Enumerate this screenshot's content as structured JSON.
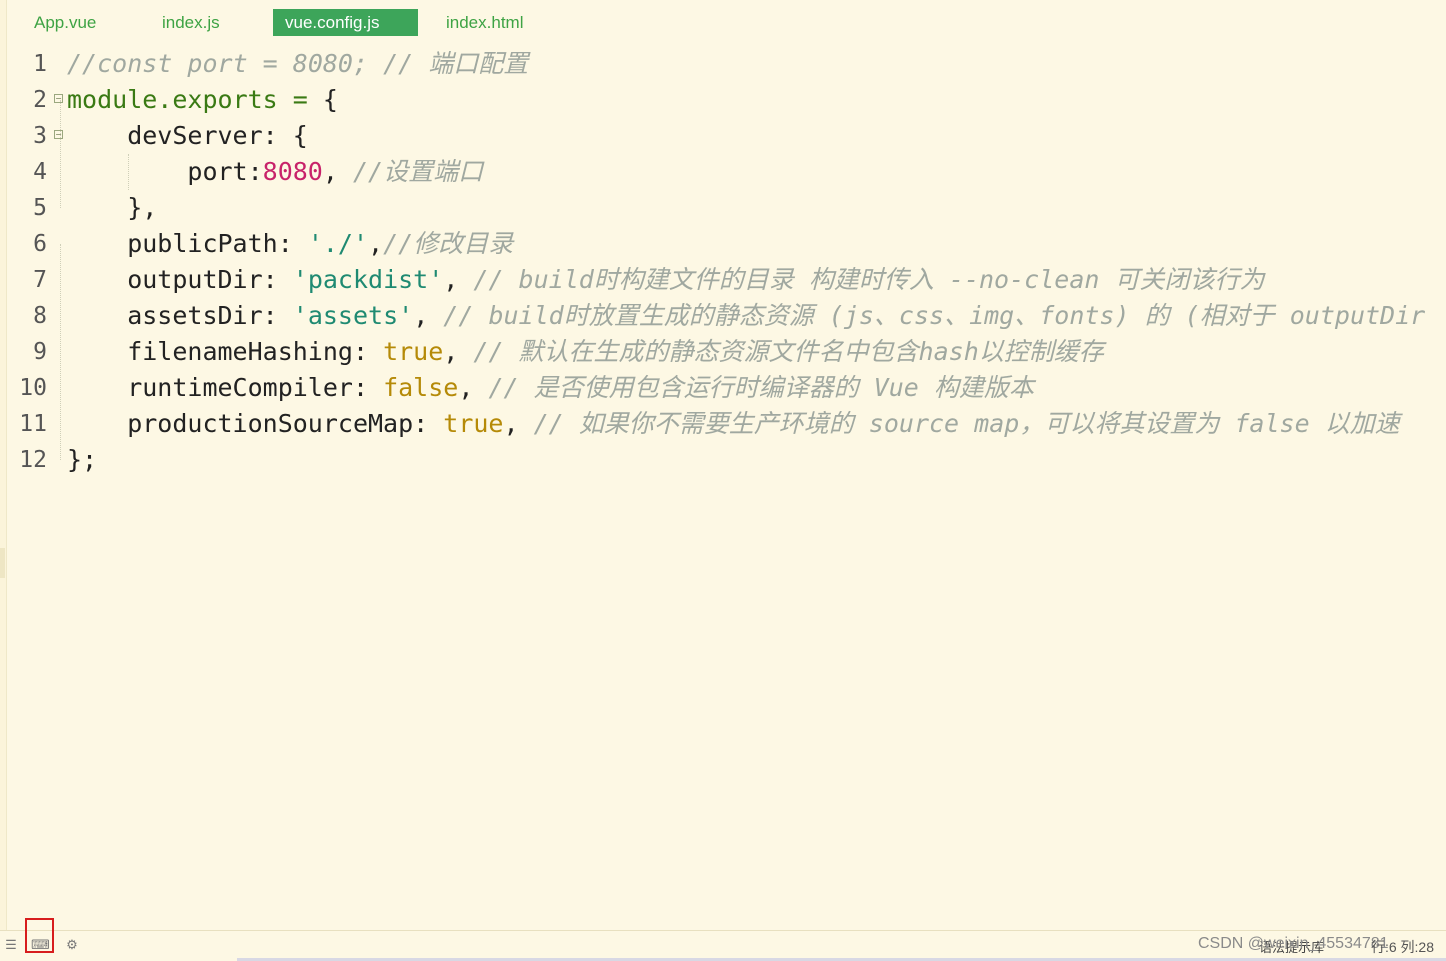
{
  "tabs": [
    {
      "label": "App.vue",
      "active": false
    },
    {
      "label": "index.js",
      "active": false
    },
    {
      "label": "vue.config.js",
      "active": true
    },
    {
      "label": "index.html",
      "active": false
    }
  ],
  "code": {
    "lines": [
      {
        "num": "1",
        "fold": false,
        "indent": 0,
        "tokens": [
          {
            "t": "//const port = 8080; // 端口配置",
            "c": "comment"
          }
        ]
      },
      {
        "num": "2",
        "fold": true,
        "indent": 0,
        "tokens": [
          {
            "t": "module.exports = ",
            "c": "kw"
          },
          {
            "t": "{",
            "c": "plain"
          }
        ]
      },
      {
        "num": "3",
        "fold": true,
        "indent": 1,
        "tokens": [
          {
            "t": "devServer: {",
            "c": "plain"
          }
        ]
      },
      {
        "num": "4",
        "fold": false,
        "indent": 2,
        "tokens": [
          {
            "t": "port:",
            "c": "plain"
          },
          {
            "t": "8080",
            "c": "num"
          },
          {
            "t": ", ",
            "c": "plain"
          },
          {
            "t": "//设置端口",
            "c": "comment"
          }
        ]
      },
      {
        "num": "5",
        "fold": false,
        "indent": 1,
        "tokens": [
          {
            "t": "},",
            "c": "plain"
          }
        ]
      },
      {
        "num": "6",
        "fold": false,
        "indent": 1,
        "tokens": [
          {
            "t": "publicPath: ",
            "c": "plain"
          },
          {
            "t": "'./'",
            "c": "str"
          },
          {
            "t": ",",
            "c": "plain"
          },
          {
            "t": "//修改目录",
            "c": "comment"
          }
        ]
      },
      {
        "num": "7",
        "fold": false,
        "indent": 1,
        "tokens": [
          {
            "t": "outputDir: ",
            "c": "plain"
          },
          {
            "t": "'packdist'",
            "c": "str"
          },
          {
            "t": ", ",
            "c": "plain"
          },
          {
            "t": "// build时构建文件的目录 构建时传入 --no-clean 可关闭该行为",
            "c": "comment"
          }
        ]
      },
      {
        "num": "8",
        "fold": false,
        "indent": 1,
        "tokens": [
          {
            "t": "assetsDir: ",
            "c": "plain"
          },
          {
            "t": "'assets'",
            "c": "str"
          },
          {
            "t": ", ",
            "c": "plain"
          },
          {
            "t": "// build时放置生成的静态资源 (js、css、img、fonts) 的 (相对于 outputDir",
            "c": "comment"
          }
        ]
      },
      {
        "num": "9",
        "fold": false,
        "indent": 1,
        "tokens": [
          {
            "t": "filenameHashing: ",
            "c": "plain"
          },
          {
            "t": "true",
            "c": "bool"
          },
          {
            "t": ", ",
            "c": "plain"
          },
          {
            "t": "// 默认在生成的静态资源文件名中包含hash以控制缓存",
            "c": "comment"
          }
        ]
      },
      {
        "num": "10",
        "fold": false,
        "indent": 1,
        "tokens": [
          {
            "t": "runtimeCompiler: ",
            "c": "plain"
          },
          {
            "t": "false",
            "c": "bool"
          },
          {
            "t": ", ",
            "c": "plain"
          },
          {
            "t": "// 是否使用包含运行时编译器的 Vue 构建版本",
            "c": "comment"
          }
        ]
      },
      {
        "num": "11",
        "fold": false,
        "indent": 1,
        "tokens": [
          {
            "t": "productionSourceMap: ",
            "c": "plain"
          },
          {
            "t": "true",
            "c": "bool"
          },
          {
            "t": ", ",
            "c": "plain"
          },
          {
            "t": "// 如果你不需要生产环境的 source map，可以将其设置为 false 以加速",
            "c": "comment"
          }
        ]
      },
      {
        "num": "12",
        "fold": false,
        "indent": 0,
        "tokens": [
          {
            "t": "};",
            "c": "plain"
          }
        ]
      }
    ]
  },
  "statusbar": {
    "icons": [
      "list-icon",
      "terminal-icon",
      "plugin-icon"
    ],
    "watermark": "CSDN @weixin_45534781",
    "hint": "语法提示库",
    "position": "行:6  列:28"
  }
}
